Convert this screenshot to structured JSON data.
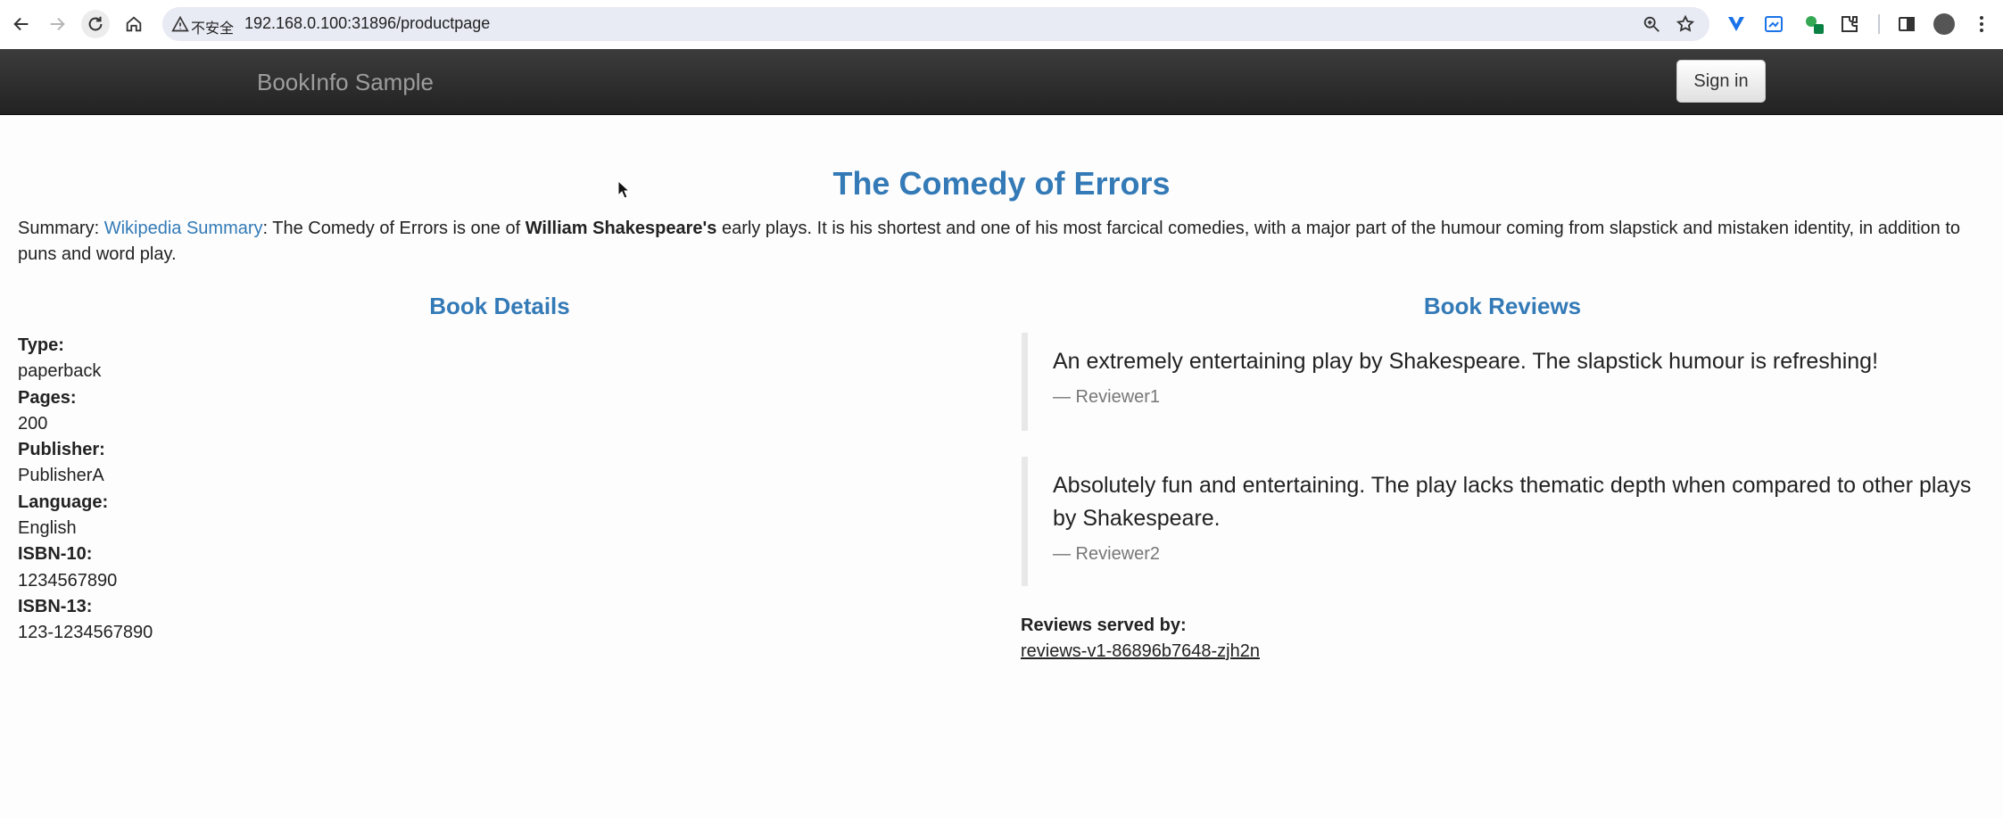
{
  "browser": {
    "security_label": "不安全",
    "url": "192.168.0.100:31896/productpage"
  },
  "navbar": {
    "brand": "BookInfo Sample",
    "signin_label": "Sign in"
  },
  "book": {
    "title": "The Comedy of Errors",
    "summary_prefix": "Summary: ",
    "summary_link": "Wikipedia Summary",
    "summary_mid": ": The Comedy of Errors is one of ",
    "summary_bold": "William Shakespeare's",
    "summary_rest": " early plays. It is his shortest and one of his most farcical comedies, with a major part of the humour coming from slapstick and mistaken identity, in addition to puns and word play."
  },
  "details": {
    "heading": "Book Details",
    "items": [
      {
        "label": "Type:",
        "value": "paperback"
      },
      {
        "label": "Pages:",
        "value": "200"
      },
      {
        "label": "Publisher:",
        "value": "PublisherA"
      },
      {
        "label": "Language:",
        "value": "English"
      },
      {
        "label": "ISBN-10:",
        "value": "1234567890"
      },
      {
        "label": "ISBN-13:",
        "value": "123-1234567890"
      }
    ]
  },
  "reviews": {
    "heading": "Book Reviews",
    "items": [
      {
        "text": "An extremely entertaining play by Shakespeare. The slapstick humour is refreshing!",
        "author": "— Reviewer1"
      },
      {
        "text": "Absolutely fun and entertaining. The play lacks thematic depth when compared to other plays by Shakespeare.",
        "author": "— Reviewer2"
      }
    ],
    "served_by_label": "Reviews served by:",
    "served_by_pod": "reviews-v1-86896b7648-zjh2n"
  },
  "icons": [
    "back-arrow-icon",
    "forward-arrow-icon",
    "reload-icon",
    "home-icon",
    "warning-icon",
    "zoom-icon",
    "star-icon",
    "extension-icon",
    "sidebar-icon",
    "avatar-icon",
    "menu-kebab-icon"
  ],
  "colors": {
    "accent": "#337ab7",
    "navbar": "#222222"
  }
}
